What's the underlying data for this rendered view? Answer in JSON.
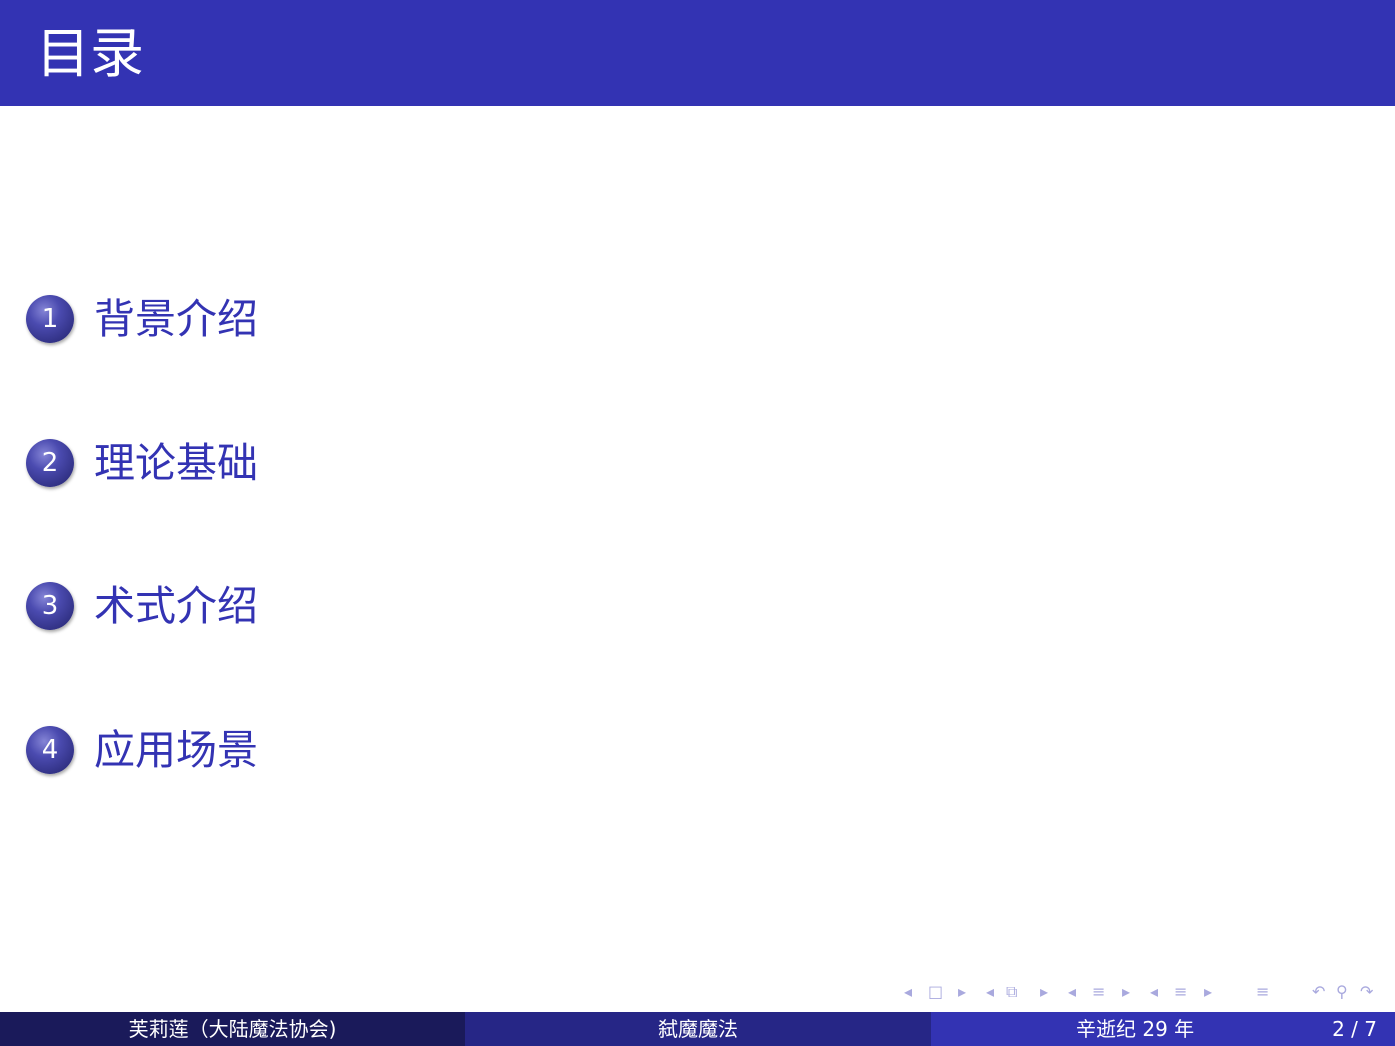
{
  "slide": {
    "title": "目录"
  },
  "toc": {
    "items": [
      {
        "number": "1",
        "label": "背景介绍"
      },
      {
        "number": "2",
        "label": "理论基础"
      },
      {
        "number": "3",
        "label": "术式介绍"
      },
      {
        "number": "4",
        "label": "应用场景"
      }
    ]
  },
  "navigation": {
    "frame_prev": "◂",
    "frame_icon": "□",
    "frame_next": "▸",
    "subsection_prev": "◂",
    "subsection_icon": "⧉",
    "subsection_next": "▸",
    "section_prev": "◂",
    "section_icon": "≡",
    "section_next": "▸",
    "part_prev": "◂",
    "part_icon": "≡",
    "part_next": "▸",
    "toc_icon": "≡",
    "back_icon": "↶",
    "search_icon": "⚲",
    "forward_icon": "↷"
  },
  "footer": {
    "author": "芙莉莲（大陆魔法协会)",
    "short_title": "弑魔魔法",
    "date": "辛逝纪 29 年",
    "page": "2 / 7"
  },
  "colors": {
    "header_bg": "#3333b3",
    "title_text": "#ffffff",
    "toc_text": "#3333b3",
    "footer_left_bg": "#1a1a5a",
    "footer_mid_bg": "#262686",
    "footer_right_bg": "#3333b3",
    "nav_icon": "#a9a9de"
  }
}
